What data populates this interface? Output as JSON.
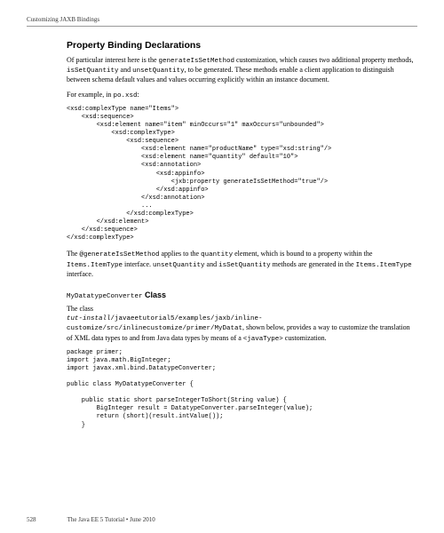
{
  "running_head": "Customizing JAXB Bindings",
  "section1": {
    "title": "Property Binding Declarations",
    "para1_a": "Of particular interest here is the ",
    "para1_b": "generateIsSetMethod",
    "para1_c": " customization, which causes two additional property methods, ",
    "para1_d": "isSetQuantity",
    "para1_e": " and ",
    "para1_f": "unsetQuantity",
    "para1_g": ", to be generated. These methods enable a client application to distinguish between schema default values and values occurring explicitly within an instance document.",
    "para2_a": "For example, in ",
    "para2_b": "po.xsd",
    "para2_c": ":",
    "code": "<xsd:complexType name=\"Items\">\n    <xsd:sequence>\n        <xsd:element name=\"item\" minOccurs=\"1\" maxOccurs=\"unbounded\">\n            <xsd:complexType>\n                <xsd:sequence>\n                    <xsd:element name=\"productName\" type=\"xsd:string\"/>\n                    <xsd:element name=\"quantity\" default=\"10\">\n                    <xsd:annotation>\n                        <xsd:appinfo>\n                            <jxb:property generateIsSetMethod=\"true\"/>\n                        </xsd:appinfo>\n                    </xsd:annotation>\n                    ...\n                </xsd:complexType>\n        </xsd:element>\n    </xsd:sequence>\n</xsd:complexType>",
    "para3_a": "The ",
    "para3_b": "@generateIsSetMethod",
    "para3_c": " applies to the ",
    "para3_d": "quantity",
    "para3_e": " element, which is bound to a property within the ",
    "para3_f": "Items.ItemType",
    "para3_g": " interface. ",
    "para3_h": "unsetQuantity",
    "para3_i": " and ",
    "para3_j": "isSetQuantity",
    "para3_k": " methods are generated in the ",
    "para3_l": "Items.ItemType",
    "para3_m": " interface."
  },
  "section2": {
    "title_light": "MyDatatypeConverter",
    "title_bold": " Class",
    "para1_a": "The class ",
    "para1_b": "tut-install",
    "para1_c": "/javaeetutorial5/examples/jaxb/inline-customize/src/inlinecustomize/primer/MyDatat",
    "para1_d": ", shown below, provides a way to customize the translation of XML data types to and from Java data types by means of a ",
    "para1_e": "<javaType>",
    "para1_f": " customization.",
    "code": "package primer;\nimport java.math.BigInteger;\nimport javax.xml.bind.DatatypeConverter;\n\npublic class MyDatatypeConverter {\n\n    public static short parseIntegerToShort(String value) {\n        BigInteger result = DatatypeConverter.parseInteger(value);\n        return (short)(result.intValue());\n    }"
  },
  "footer": {
    "page_number": "528",
    "book_title": "The Java EE 5 Tutorial • June 2010"
  }
}
